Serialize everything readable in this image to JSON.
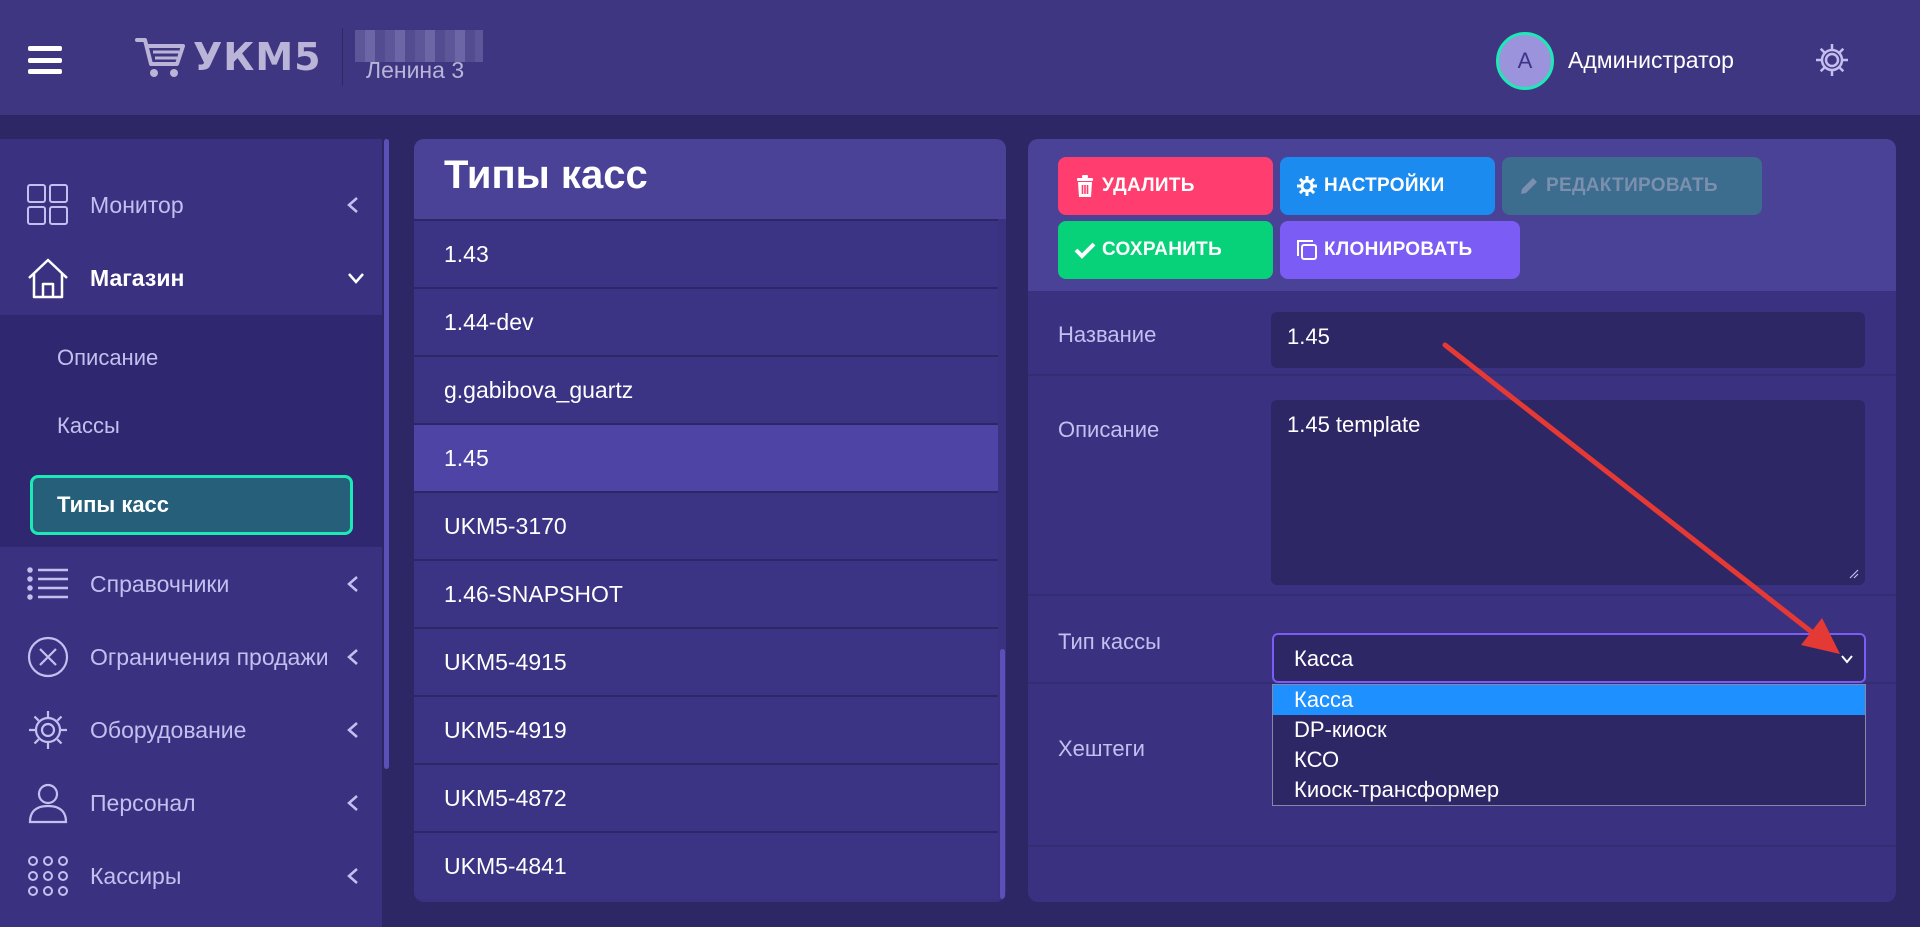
{
  "header": {
    "app_name": "УКМ5",
    "store_name": "Ленина 3",
    "user_initial": "A",
    "user_name": "Администратор"
  },
  "sidebar": {
    "items": [
      {
        "label": "Монитор",
        "icon": "dashboard-icon",
        "expanded": false
      },
      {
        "label": "Магазин",
        "icon": "home-icon",
        "expanded": true
      },
      {
        "label": "Справочники",
        "icon": "list-icon",
        "expanded": false
      },
      {
        "label": "Ограничения продажи",
        "icon": "cancel-circle-icon",
        "expanded": false
      },
      {
        "label": "Оборудование",
        "icon": "gear-icon",
        "expanded": false
      },
      {
        "label": "Персонал",
        "icon": "person-icon",
        "expanded": false
      },
      {
        "label": "Кассиры",
        "icon": "grid-dots-icon",
        "expanded": false
      }
    ],
    "submenu": [
      "Описание",
      "Кассы",
      "Типы касс"
    ],
    "submenu_current": "Типы касс"
  },
  "list": {
    "title": "Типы касс",
    "rows": [
      "1.43",
      "1.44-dev",
      "g.gabibova_guartz",
      "1.45",
      "UKM5-3170",
      "1.46-SNAPSHOT",
      "UKM5-4915",
      "UKM5-4919",
      "UKM5-4872",
      "UKM5-4841"
    ],
    "selected": "1.45"
  },
  "toolbar": {
    "delete_label": "УДАЛИТЬ",
    "settings_label": "НАСТРОЙКИ",
    "edit_label": "РЕДАКТИРОВАТЬ",
    "save_label": "СОХРАНИТЬ",
    "clone_label": "КЛОНИРОВАТЬ"
  },
  "form": {
    "name_label": "Название",
    "name_value": "1.45",
    "description_label": "Описание",
    "description_value": "1.45 template",
    "type_label": "Тип кассы",
    "type_value": "Касса",
    "tags_label": "Хештеги",
    "type_options": [
      "Касса",
      "DP-киоск",
      "КСО",
      "Киоск-трансформер"
    ]
  },
  "colors": {
    "background": "#2d2766",
    "header": "#3e3680",
    "accent_teal": "#1de9b6",
    "delete": "#ff3d6e",
    "settings": "#1c8bf0",
    "save": "#07d27a",
    "clone": "#7b5cf5",
    "highlight": "#1e90ff",
    "annotation_arrow": "#e53935"
  }
}
